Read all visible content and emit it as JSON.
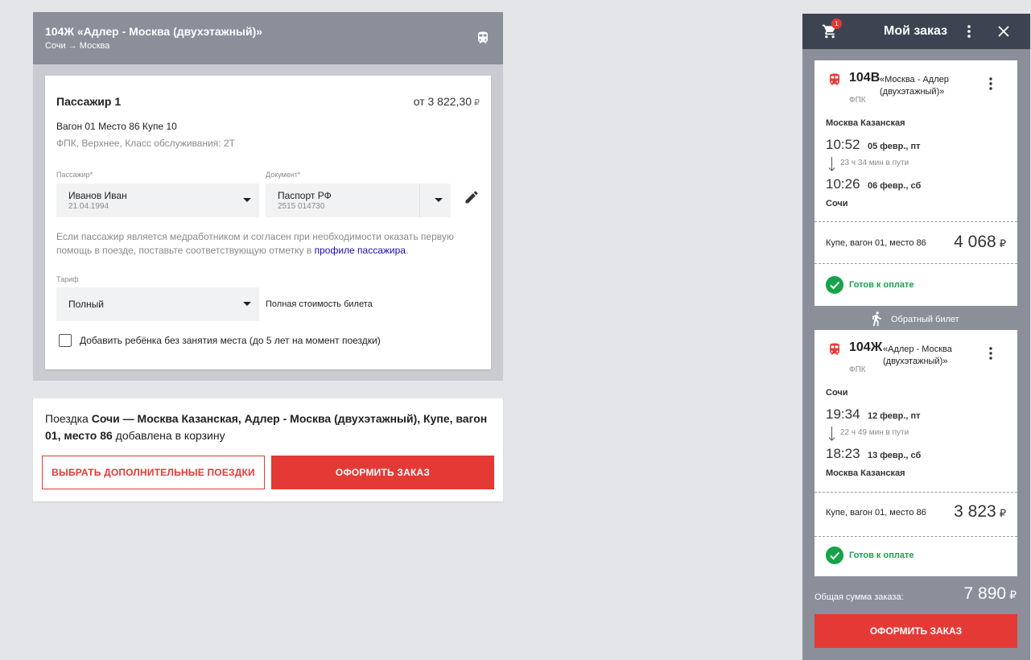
{
  "trip": {
    "title": "104Ж «Адлер - Москва (двухэтажный)»",
    "route": "Сочи → Москва"
  },
  "passenger": {
    "title": "Пассажир 1",
    "price_prefix": "от 3 822,30",
    "price_currency": "₽",
    "seat_line": "Вагон 01 Место 86 Купе 10",
    "class_line": "ФПК, Верхнее,  Класс обслуживания: 2Т",
    "passenger_label": "Пассажир*",
    "passenger_name": "Иванов Иван",
    "passenger_dob": "21.04.1994",
    "document_label": "Документ*",
    "document_type": "Паспорт РФ",
    "document_number": "2515 014730",
    "info_text": "Если пассажир является медработником и согласен при необходимости оказать первую помощь в поезде, поставьте соответствующую отметку в ",
    "info_link": "профиле пассажира",
    "info_end": ".",
    "tariff_label": "Тариф",
    "tariff_value": "Полный",
    "tariff_note": "Полная стоимость билета",
    "child_checkbox_label": "Добавить ребёнка без занятия места (до 5 лет на момент поездки)"
  },
  "added": {
    "prefix": "Поездка ",
    "bold": "Сочи — Москва Казанская, Адлер - Москва (двухэтажный), Купе, вагон 01, место 86",
    "suffix": " добавлена в корзину",
    "more_trips_button": "ВЫБРАТЬ ДОПОЛНИТЕЛЬНЫЕ ПОЕЗДКИ",
    "checkout_button": "ОФОРМИТЬ ЗАКАЗ"
  },
  "order": {
    "title": "Мой заказ",
    "cart_count": "1",
    "items": [
      {
        "number": "104В",
        "name": "«Москва - Адлер (двухэтажный)»",
        "carrier": "ФПК",
        "from": "Москва Казанская",
        "dep_time": "10:52",
        "dep_date": "05 февр., пт",
        "duration": "23 ч 34 мин в пути",
        "arr_time": "10:26",
        "arr_date": "06 февр., сб",
        "to": "Сочи",
        "seat": "Купе, вагон 01, место 86",
        "price": "4 068",
        "status": "Готов к оплате"
      },
      {
        "number": "104Ж",
        "name": "«Адлер - Москва (двухэтажный)»",
        "carrier": "ФПК",
        "from": "Сочи",
        "dep_time": "19:34",
        "dep_date": "12 февр., пт",
        "duration": "22 ч 49 мин в пути",
        "arr_time": "18:23",
        "arr_date": "13 февр., сб",
        "to": "Москва Казанская",
        "seat": "Купе, вагон 01, место 86",
        "price": "3 823",
        "status": "Готов к оплате"
      }
    ],
    "return_label": "Обратный билет",
    "total_label": "Общая сумма заказа:",
    "total_value": "7 890",
    "currency": "₽",
    "checkout_button": "ОФОРМИТЬ ЗАКАЗ"
  },
  "colors": {
    "accent_red": "#e53935",
    "header_gray": "#8a8f99",
    "panel_dark": "#3c4452",
    "status_green": "#17a34a"
  },
  "icons": [
    "train-icon",
    "pencil-icon",
    "cart-icon",
    "kebab-icon",
    "close-icon",
    "walk-icon",
    "check-icon",
    "arrow-down-icon"
  ]
}
